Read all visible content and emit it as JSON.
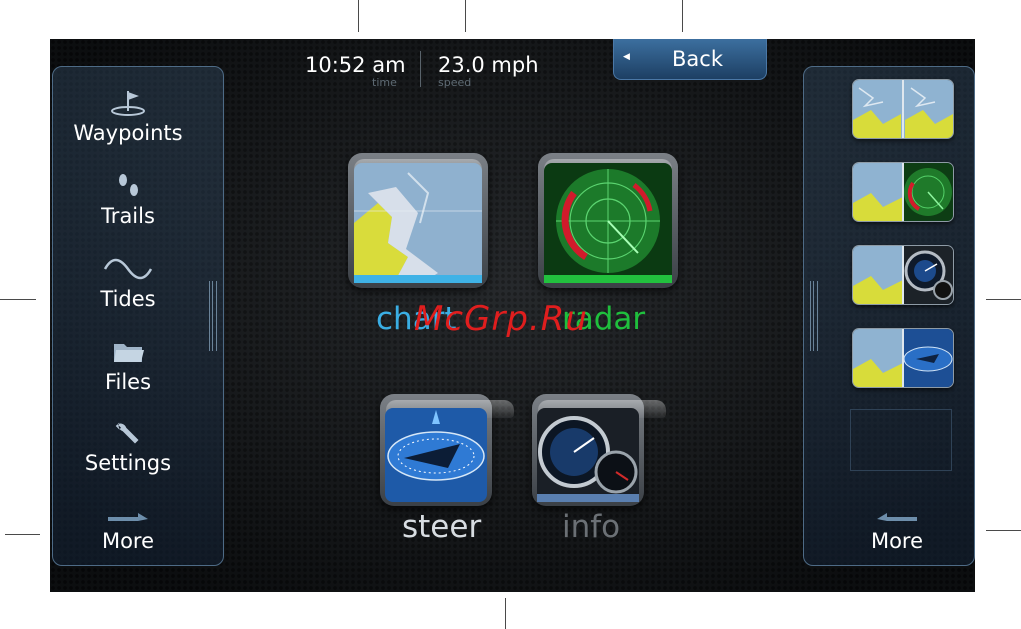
{
  "status": {
    "time_value": "10:52 am",
    "time_caption": "time",
    "speed_value": "23.0 mph",
    "speed_caption": "speed"
  },
  "back_button": {
    "label": "Back",
    "icon": "triangle-left-icon"
  },
  "left_menu": {
    "items": [
      {
        "label": "Waypoints",
        "icon": "waypoint-flag-icon"
      },
      {
        "label": "Trails",
        "icon": "footprints-icon"
      },
      {
        "label": "Tides",
        "icon": "sine-wave-icon"
      },
      {
        "label": "Files",
        "icon": "folder-icon"
      },
      {
        "label": "Settings",
        "icon": "wrench-icon"
      },
      {
        "label": "More",
        "icon": "arrow-right-icon"
      }
    ]
  },
  "apps": [
    {
      "label": "chart",
      "color": "#3aaee4",
      "icon": "chart-map-icon"
    },
    {
      "label": "radar",
      "color": "#1fbf3d",
      "icon": "radar-icon"
    },
    {
      "label": "steer",
      "color": "#d8dde2",
      "icon": "compass-icon"
    },
    {
      "label": "info",
      "color": "#6b7075",
      "icon": "gauge-icon"
    }
  ],
  "right_menu": {
    "layouts": [
      {
        "icon": "chart-chart-layout-icon"
      },
      {
        "icon": "chart-radar-layout-icon"
      },
      {
        "icon": "chart-gauge-layout-icon"
      },
      {
        "icon": "chart-compass-layout-icon"
      },
      {
        "icon": "empty-layout-slot"
      }
    ],
    "more": {
      "label": "More",
      "icon": "arrow-left-icon"
    }
  },
  "watermark": "McGrp.Ru",
  "colors": {
    "accent": "#3c6f9f",
    "panel_border": "#4e6b86",
    "background": "#16191c"
  }
}
